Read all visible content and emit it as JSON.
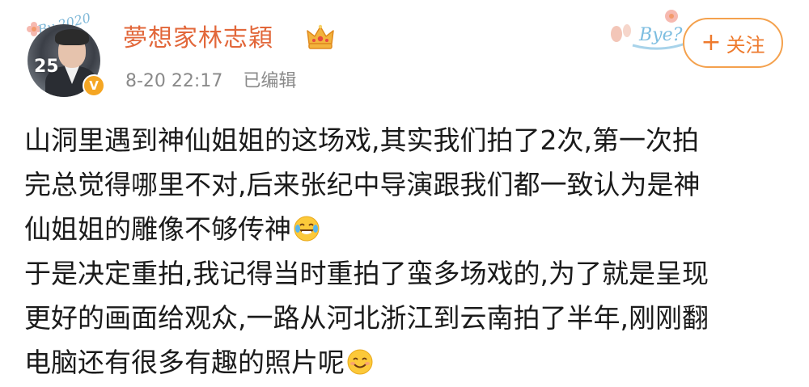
{
  "post": {
    "author": {
      "name": "夢想家林志穎",
      "avatar_number": "25",
      "avatar_script": "By 2020",
      "badge_icon": "verified-v-icon",
      "badge_glyph": "V",
      "crown_icon": "crown-icon"
    },
    "meta": {
      "timestamp": "8-20 22:17",
      "edited": "已编辑"
    },
    "decoration": {
      "sticker_text": "Bye?"
    },
    "follow": {
      "plus": "+",
      "label": "关注"
    },
    "lines": [
      "山洞里遇到神仙姐姐的这场戏,其实我们拍了2次,第一次拍",
      "完总觉得哪里不对,后来张纪中导演跟我们都一致认为是神",
      "仙姐姐的雕像不够传神",
      "于是决定重拍,我记得当时重拍了蛮多场戏的,为了就是呈现",
      "更好的画面给观众,一路从河北浙江到云南拍了半年,刚刚翻",
      "电脑还有很多有趣的照片呢"
    ],
    "emojis": {
      "line3": "laughing-tears-emoji",
      "line6": "smile-emoji"
    },
    "colors": {
      "username": "#e2673a",
      "follow_border": "#f4a14d",
      "follow_text": "#ee7a2d",
      "badge": "#f5a623",
      "meta": "#8a8a8a"
    }
  }
}
